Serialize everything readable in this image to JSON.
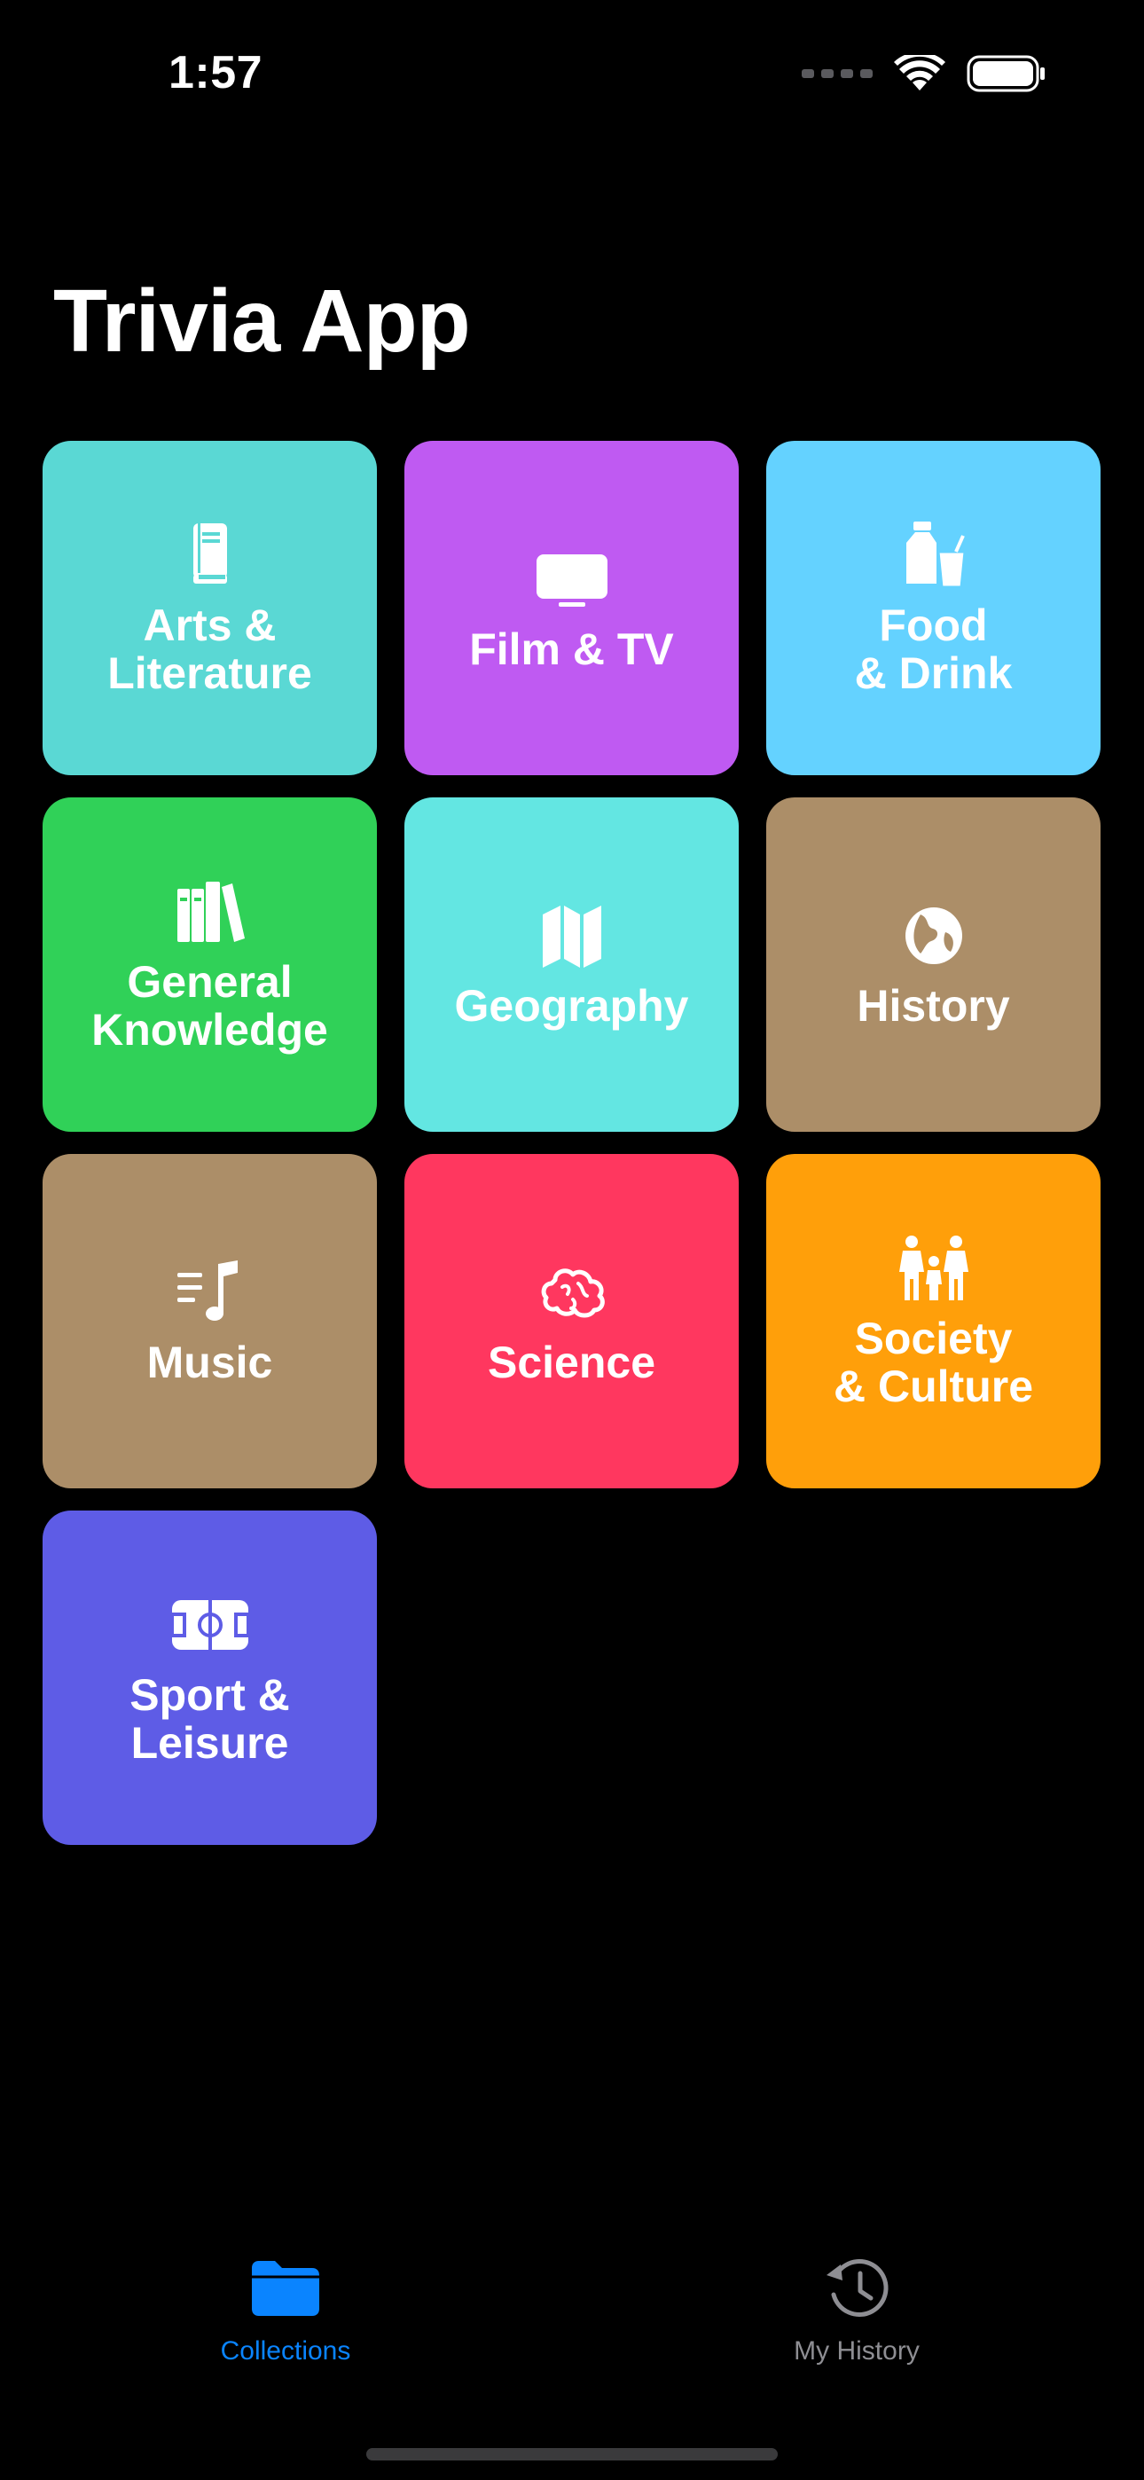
{
  "status_bar": {
    "time": "1:57"
  },
  "title": "Trivia App",
  "categories": [
    {
      "label": "Arts &\nLiterature",
      "color": "#5ad8d4",
      "icon": "book-icon"
    },
    {
      "label": "Film & TV",
      "color": "#bf5af2",
      "icon": "tv-icon"
    },
    {
      "label": "Food\n& Drink",
      "color": "#64d2ff",
      "icon": "food-drink-icon"
    },
    {
      "label": "General\nKnowledge",
      "color": "#30d158",
      "icon": "books-icon"
    },
    {
      "label": "Geography",
      "color": "#63e6e2",
      "icon": "map-icon"
    },
    {
      "label": "History",
      "color": "#ac8e68",
      "icon": "globe-icon"
    },
    {
      "label": "Music",
      "color": "#ac8e68",
      "icon": "music-note-list-icon"
    },
    {
      "label": "Science",
      "color": "#ff375f",
      "icon": "brain-icon"
    },
    {
      "label": "Society\n& Culture",
      "color": "#ff9f0a",
      "icon": "family-icon"
    },
    {
      "label": "Sport &\nLeisure",
      "color": "#5e5ce6",
      "icon": "sports-field-icon"
    }
  ],
  "tab_bar": {
    "collections": {
      "label": "Collections",
      "icon": "folder-icon",
      "color": "#0a84ff"
    },
    "history": {
      "label": "My History",
      "icon": "clock-history-icon",
      "color": "#8e8e93"
    }
  }
}
